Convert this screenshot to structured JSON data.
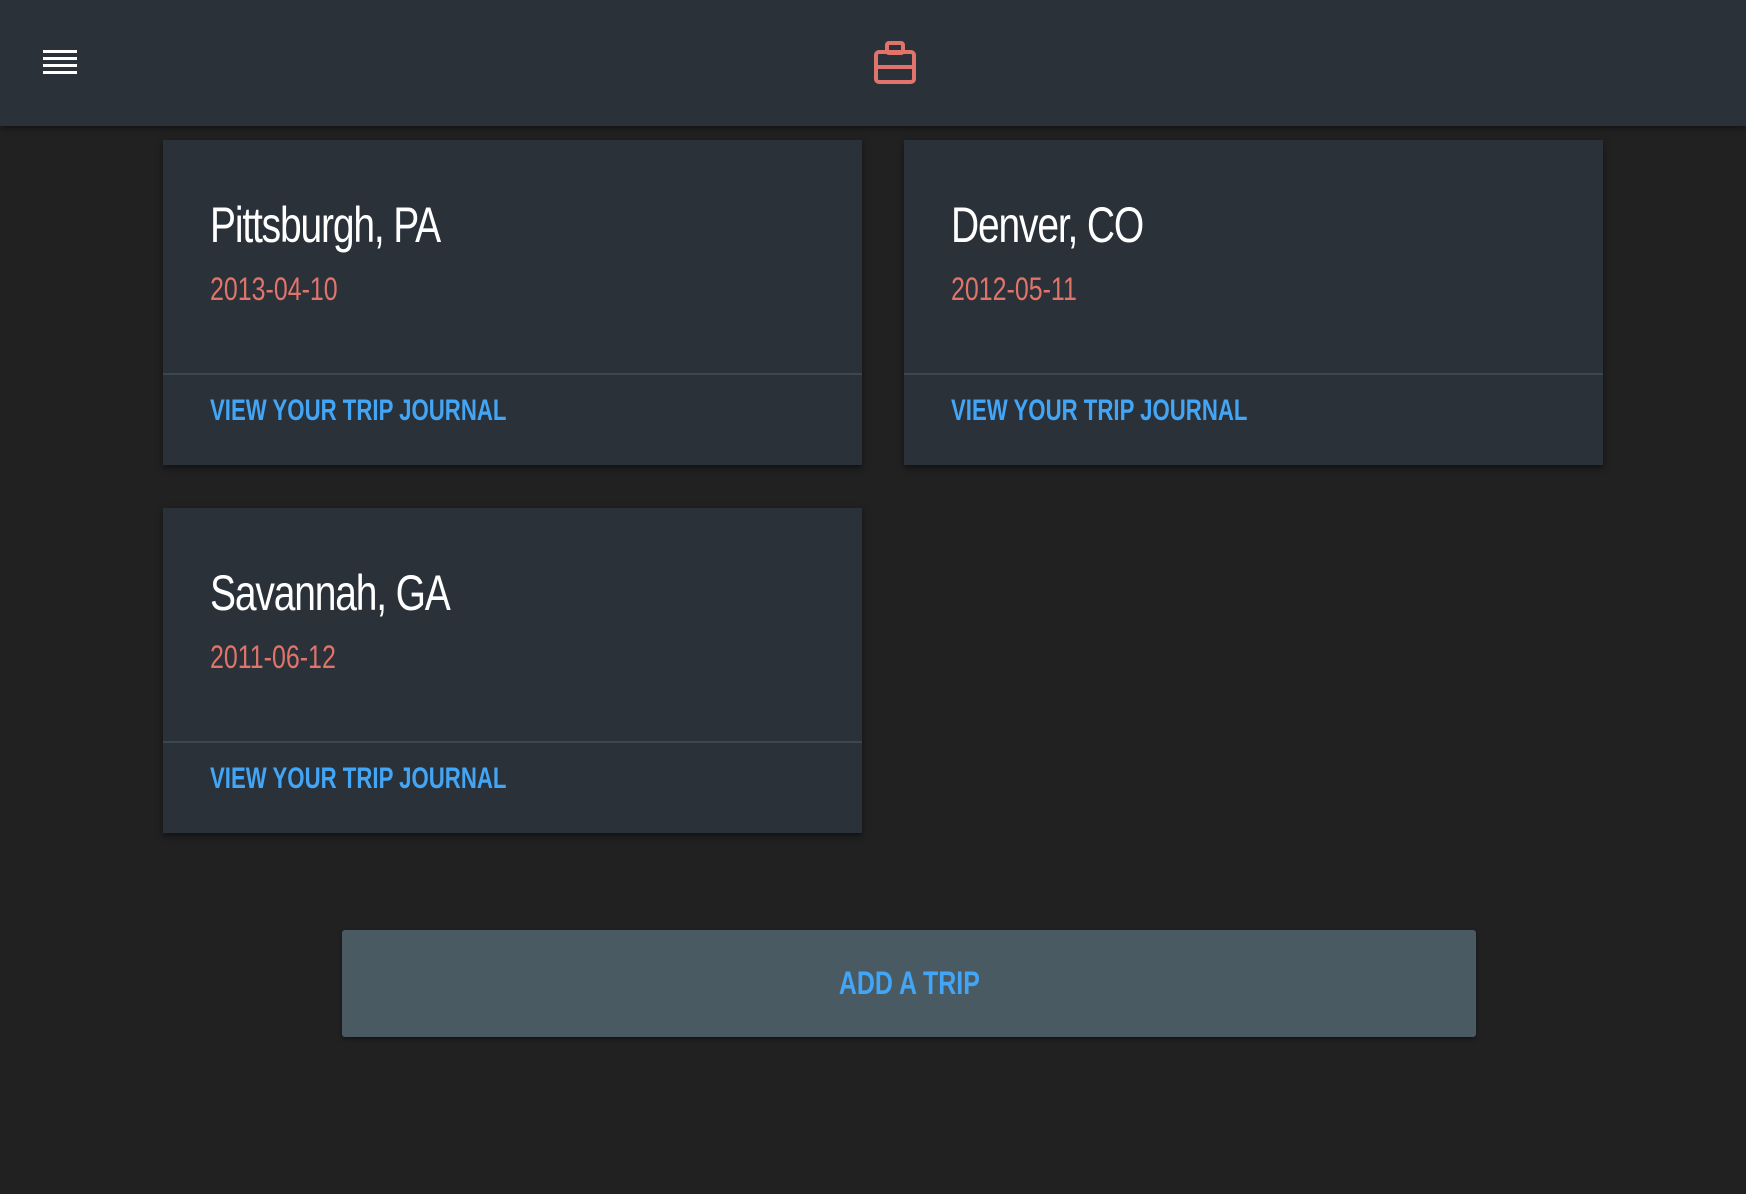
{
  "header": {
    "menu_icon": "hamburger-menu-icon",
    "brand_icon": "briefcase-icon",
    "accent_color": "#e0746b"
  },
  "trips": [
    {
      "city": "Pittsburgh, PA",
      "date": "2013-04-10",
      "link": "VIEW YOUR TRIP JOURNAL"
    },
    {
      "city": "Denver, CO",
      "date": "2012-05-11",
      "link": "VIEW YOUR TRIP JOURNAL"
    },
    {
      "city": "Savannah, GA",
      "date": "2011-06-12",
      "link": "VIEW YOUR TRIP JOURNAL"
    }
  ],
  "actions": {
    "add_trip_label": "ADD A TRIP"
  },
  "colors": {
    "background": "#212121",
    "card": "#2a3139",
    "link": "#42a5f5",
    "date": "#e0746b",
    "button": "#4a5a63"
  }
}
